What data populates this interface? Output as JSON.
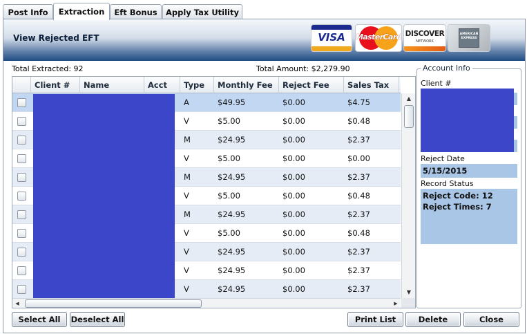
{
  "tabs": [
    "Post Info",
    "Extraction",
    "Eft Bonus",
    "Apply Tax Utility"
  ],
  "active_tab": "Extraction",
  "banner": {
    "title": "View Rejected EFT",
    "cards": {
      "visa": "VISA",
      "mastercard": "MasterCard",
      "discover": "DISCOVER",
      "discover_sub": "NETWORK",
      "amex": "AMERICAN EXPRESS"
    }
  },
  "summary": {
    "total_extracted": "Total Extracted: 92",
    "total_amount": "Total Amount: $2,279.90"
  },
  "grid": {
    "columns": [
      "Client #",
      "Name",
      "Acct",
      "Type",
      "Monthly Fee",
      "Reject Fee",
      "Sales Tax"
    ],
    "rows": [
      {
        "type": "A",
        "monthly_fee": "$49.95",
        "reject_fee": "$0.00",
        "sales_tax": "$4.75"
      },
      {
        "type": "V",
        "monthly_fee": "$5.00",
        "reject_fee": "$0.00",
        "sales_tax": "$0.48"
      },
      {
        "type": "M",
        "monthly_fee": "$24.95",
        "reject_fee": "$0.00",
        "sales_tax": "$2.37"
      },
      {
        "type": "V",
        "monthly_fee": "$5.00",
        "reject_fee": "$0.00",
        "sales_tax": "$0.00"
      },
      {
        "type": "M",
        "monthly_fee": "$24.95",
        "reject_fee": "$0.00",
        "sales_tax": "$2.37"
      },
      {
        "type": "V",
        "monthly_fee": "$5.00",
        "reject_fee": "$0.00",
        "sales_tax": "$0.48"
      },
      {
        "type": "M",
        "monthly_fee": "$24.95",
        "reject_fee": "$0.00",
        "sales_tax": "$2.37"
      },
      {
        "type": "V",
        "monthly_fee": "$5.00",
        "reject_fee": "$0.00",
        "sales_tax": "$0.48"
      },
      {
        "type": "V",
        "monthly_fee": "$24.95",
        "reject_fee": "$0.00",
        "sales_tax": "$2.37"
      },
      {
        "type": "V",
        "monthly_fee": "$24.95",
        "reject_fee": "$0.00",
        "sales_tax": "$2.37"
      },
      {
        "type": "V",
        "monthly_fee": "$24.95",
        "reject_fee": "$0.00",
        "sales_tax": "$2.37"
      }
    ]
  },
  "account_info": {
    "legend": "Account Info",
    "client_label": "Client #",
    "reject_date_label": "Reject Date",
    "reject_date": "5/15/2015",
    "record_status_label": "Record Status",
    "reject_code": "Reject Code: 12",
    "reject_times": "Reject Times: 7"
  },
  "buttons": {
    "select_all": "Select All",
    "deselect_all": "Deselect All",
    "print_list": "Print List",
    "delete": "Delete",
    "close": "Close"
  },
  "colors": {
    "redaction": "#3c46c8",
    "selected_row": "#c2d8f2",
    "field_bg": "#aac6e6"
  }
}
